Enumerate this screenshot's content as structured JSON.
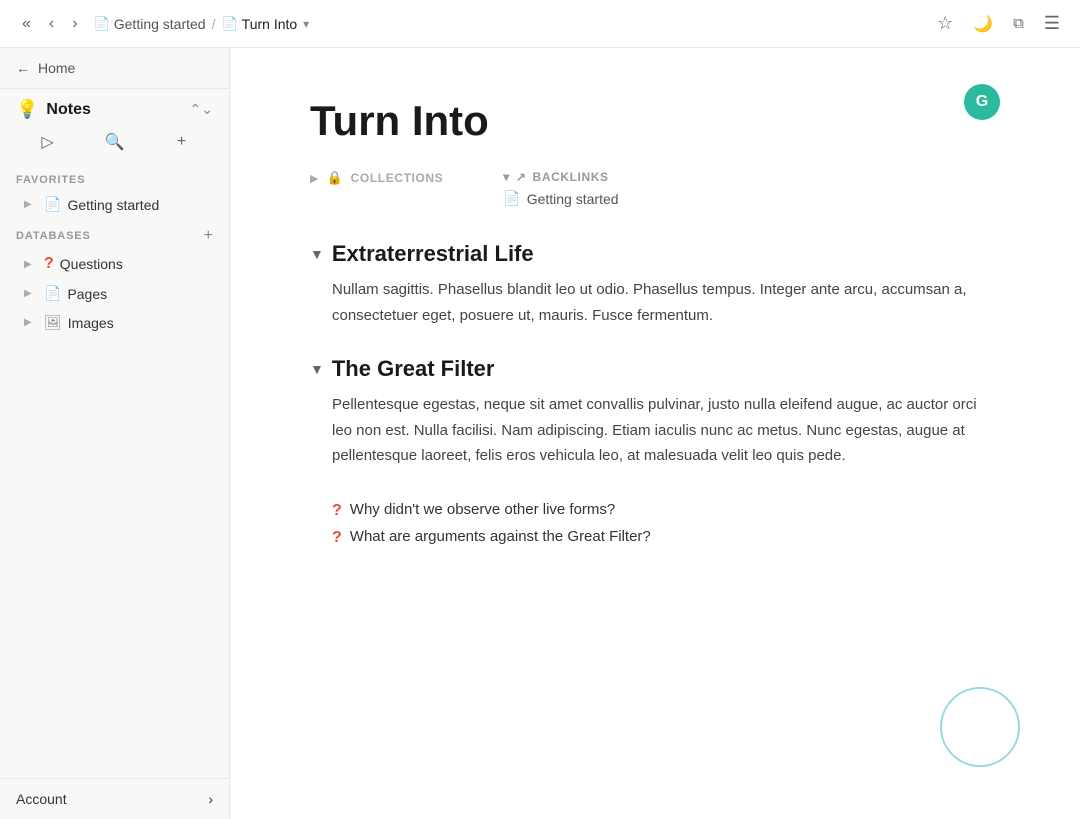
{
  "topbar": {
    "home_label": "Home",
    "nav": {
      "back_prev": "‹‹",
      "back": "‹",
      "forward": "›"
    },
    "breadcrumb": [
      {
        "label": "Getting started",
        "icon": "📄"
      },
      {
        "label": "Turn Into",
        "icon": "📄",
        "current": true
      }
    ],
    "chevron": "▾",
    "icons": {
      "star": "☆",
      "moon": "🌙",
      "layers": "⧉",
      "menu": "☰"
    }
  },
  "sidebar": {
    "home_label": "Home",
    "title": "Notes",
    "title_icon": "💡",
    "actions": {
      "play": "▷",
      "search": "🔍",
      "add": "+"
    },
    "favorites_label": "FAVORITES",
    "favorites_items": [
      {
        "label": "Getting started",
        "icon": "📄",
        "has_expand": true
      }
    ],
    "databases_label": "DATABASES",
    "databases_items": [
      {
        "label": "Questions",
        "icon": "?",
        "icon_type": "red",
        "has_expand": true
      },
      {
        "label": "Pages",
        "icon": "📄",
        "has_expand": true
      },
      {
        "label": "Images",
        "icon": "🖼",
        "has_expand": true
      }
    ],
    "account_label": "Account"
  },
  "page": {
    "title": "Turn Into",
    "avatar_letter": "G",
    "collections_label": "COLLECTIONS",
    "backlinks_label": "BACKLINKS",
    "backlinks_items": [
      {
        "label": "Getting started",
        "icon": "📄"
      }
    ],
    "sections": [
      {
        "id": "extraterrestrial",
        "heading": "Extraterrestrial Life",
        "body": "Nullam sagittis. Phasellus blandit leo ut odio. Phasellus tempus. Integer ante arcu, accumsan a, consectetuer eget, posuere ut, mauris. Fusce fermentum."
      },
      {
        "id": "great-filter",
        "heading": "The Great Filter",
        "body": "Pellentesque egestas, neque sit amet convallis pulvinar, justo nulla eleifend augue, ac auctor orci leo non est. Nulla facilisi. Nam adipiscing. Etiam iaculis nunc ac metus. Nunc egestas, augue at pellentesque laoreet, felis eros vehicula leo, at malesuada velit leo quis pede."
      }
    ],
    "questions": [
      {
        "text": "Why didn't we observe other live forms?"
      },
      {
        "text": "What are arguments against the Great Filter?"
      }
    ]
  }
}
